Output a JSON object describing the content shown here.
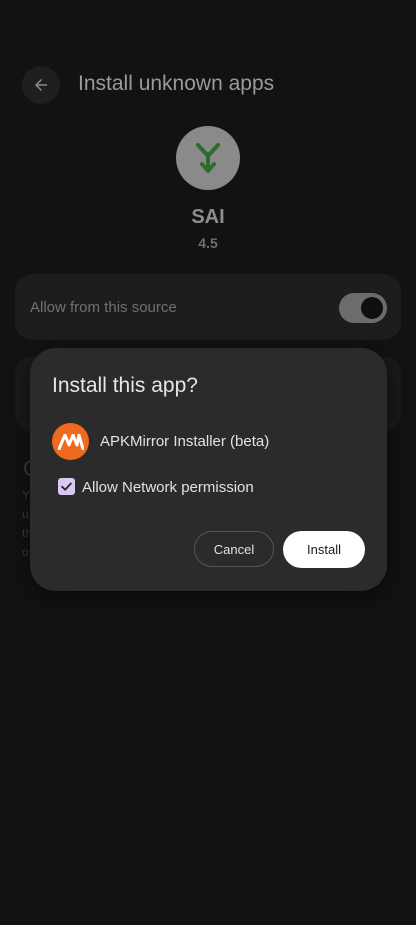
{
  "background": {
    "title": "Install unknown apps",
    "app_name": "SAI",
    "app_version": "4.5",
    "allow_label": "Allow from this source",
    "allow_enabled": true,
    "faint_letter": "C",
    "faint_lines": [
      "Y",
      "u",
      "th",
      "o"
    ]
  },
  "dialog": {
    "title": "Install this app?",
    "app_name": "APKMirror Installer (beta)",
    "permission_label": "Allow Network permission",
    "permission_checked": true,
    "cancel_label": "Cancel",
    "install_label": "Install"
  },
  "colors": {
    "dialog_bg": "#2b2b2b",
    "apk_icon_orange": "#ee6a1f",
    "checkbox_fill": "#d9c8ef"
  }
}
